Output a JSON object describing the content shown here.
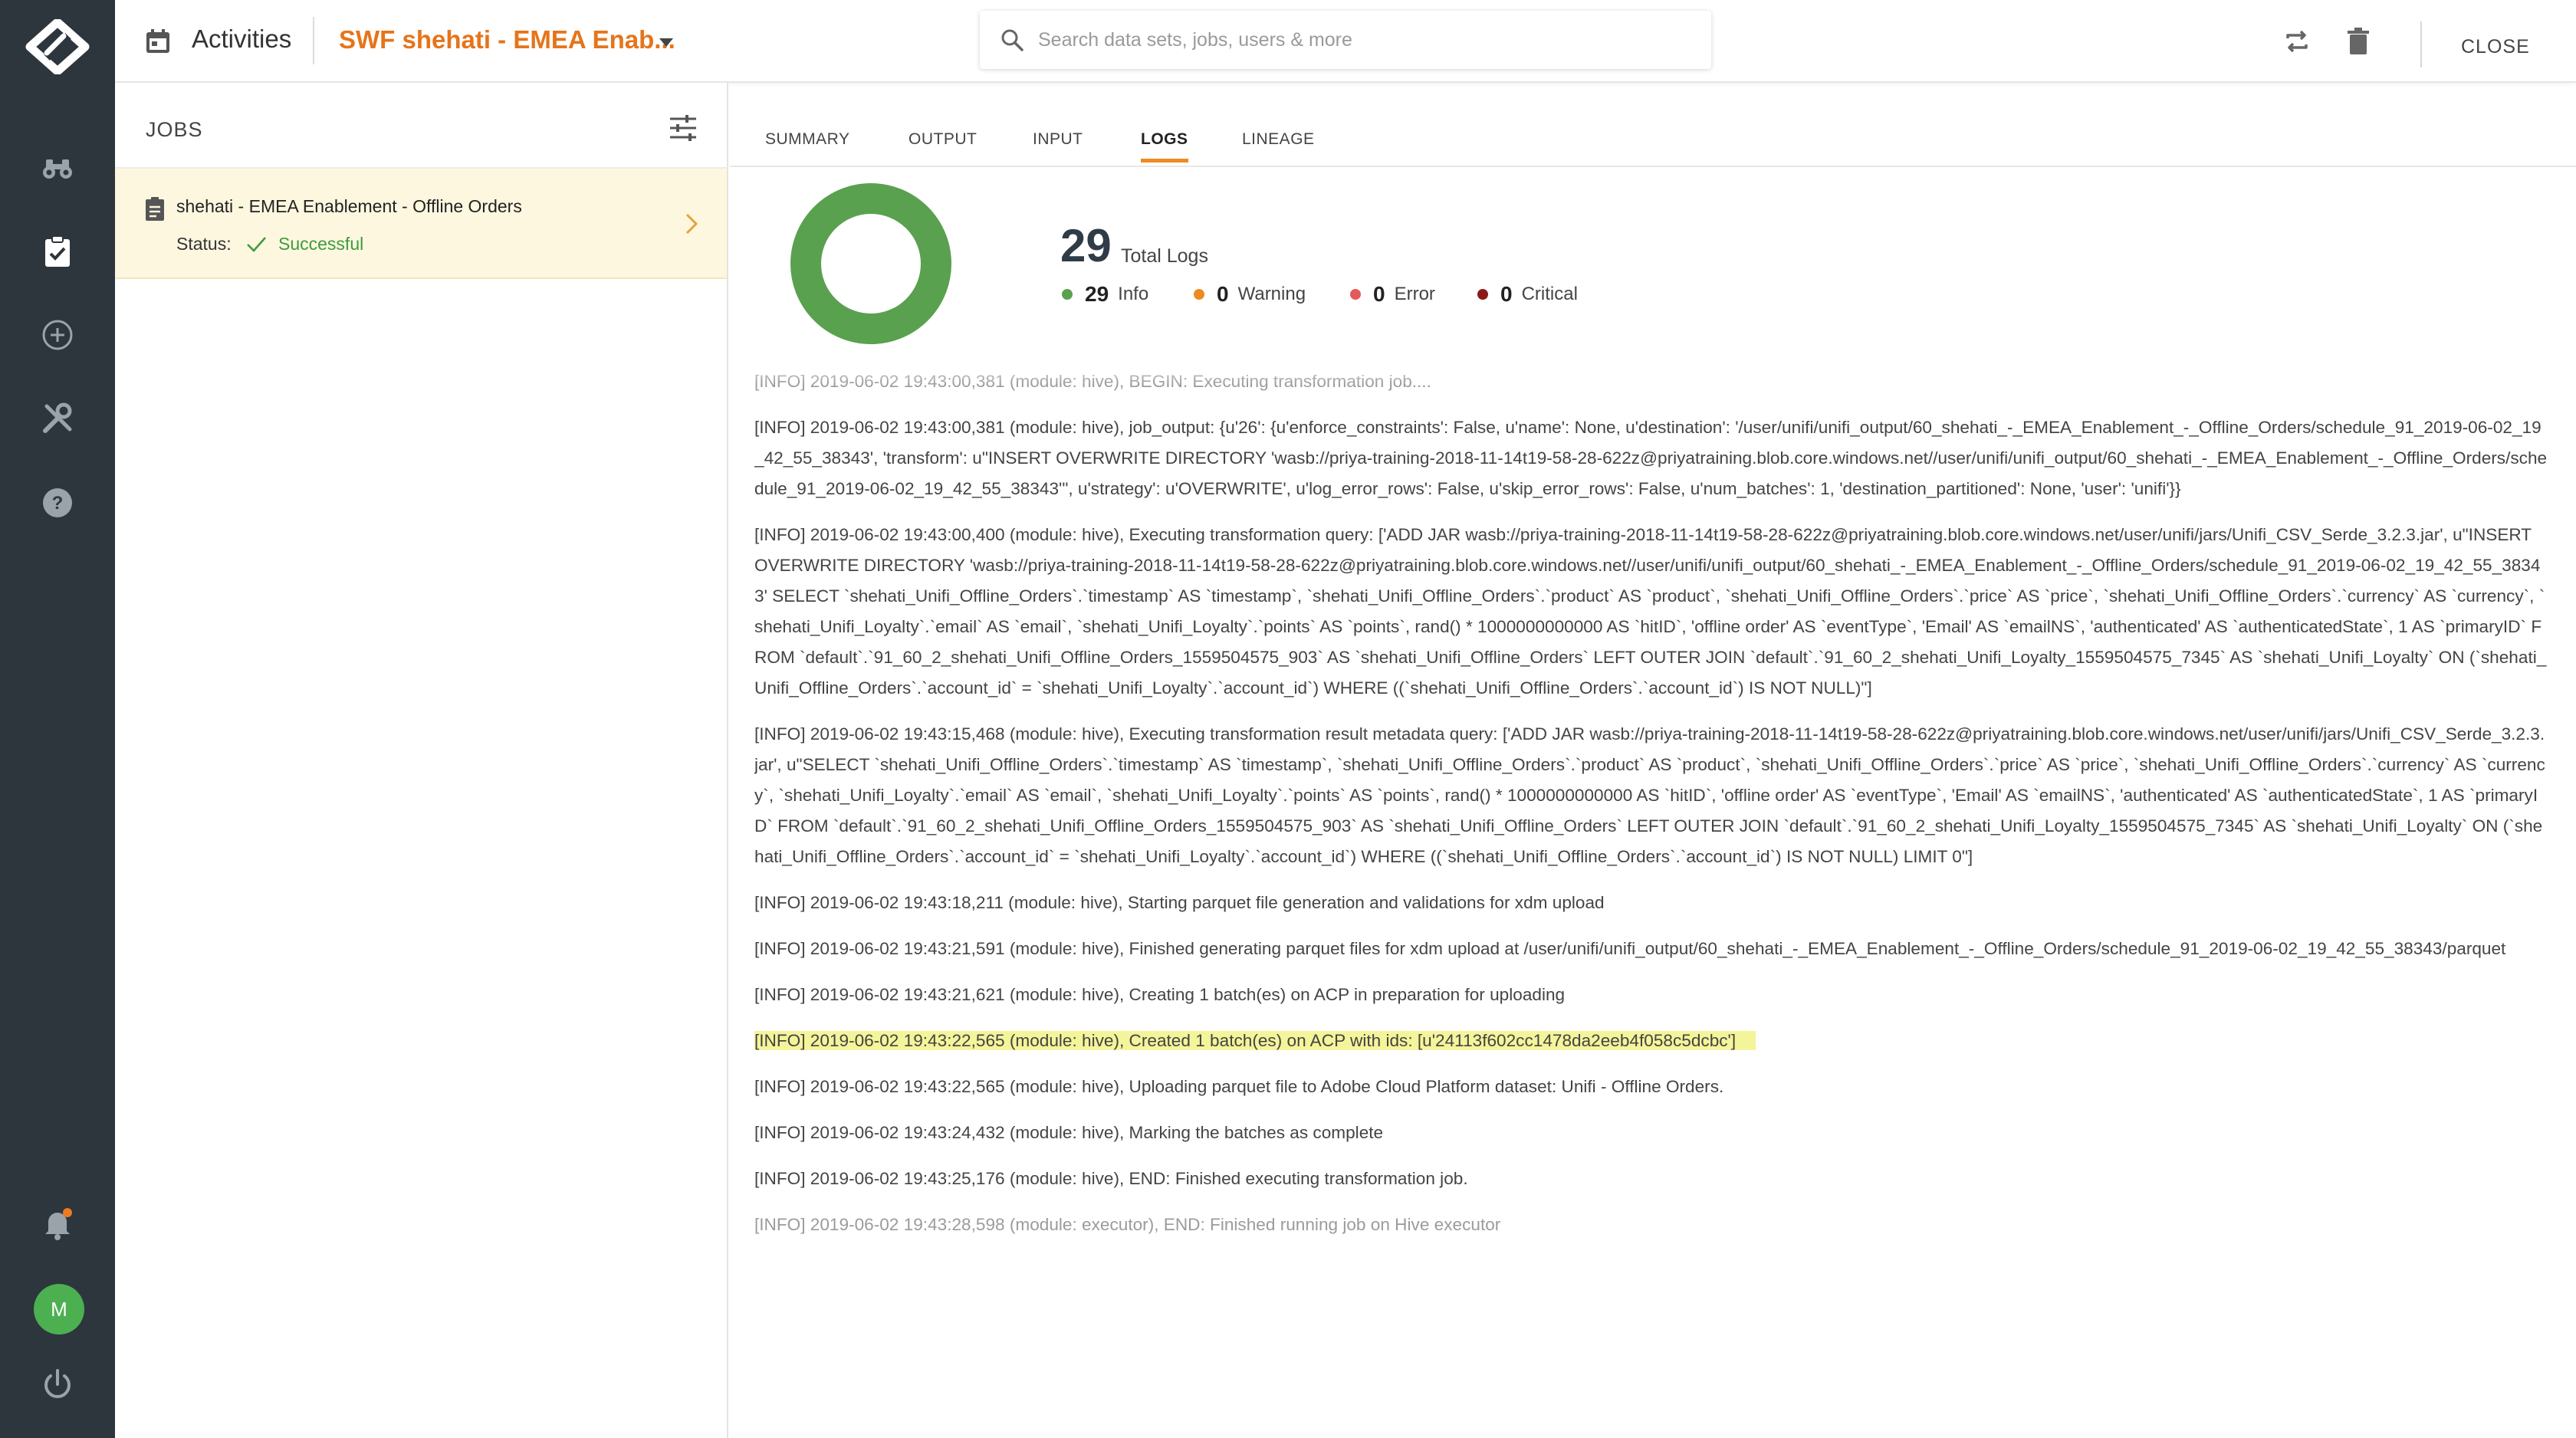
{
  "header": {
    "section": "Activities",
    "job_title": "SWF shehati - EMEA Enab...",
    "search_placeholder": "Search data sets, jobs, users & more",
    "close_label": "CLOSE"
  },
  "nav": {
    "items": [
      "binoculars-icon",
      "clipboard-check-icon",
      "plus-circle-icon",
      "tools-icon",
      "help-icon"
    ],
    "bottom": [
      "bell-icon",
      "avatar",
      "power-icon"
    ],
    "avatar_initial": "M",
    "notification_color": "#ee7a22"
  },
  "jobs_panel": {
    "heading": "JOBS",
    "items": [
      {
        "name": "shehati - EMEA Enablement - Offline Orders",
        "status_label": "Status:",
        "status": "Successful"
      }
    ]
  },
  "tabs": [
    {
      "label": "SUMMARY",
      "active": false
    },
    {
      "label": "OUTPUT",
      "active": false
    },
    {
      "label": "INPUT",
      "active": false
    },
    {
      "label": "LOGS",
      "active": true
    },
    {
      "label": "LINEAGE",
      "active": false
    }
  ],
  "summary": {
    "total": "29",
    "total_label": "Total Logs",
    "counts": [
      {
        "num": "29",
        "label": "Info",
        "color": "#5aa14f"
      },
      {
        "num": "0",
        "label": "Warning",
        "color": "#ee8a1f"
      },
      {
        "num": "0",
        "label": "Error",
        "color": "#e45a5a"
      },
      {
        "num": "0",
        "label": "Critical",
        "color": "#8b1a1a"
      }
    ],
    "donut_color": "#5aa14f"
  },
  "logs": [
    "[INFO] 2019-06-02 19:43:00,381 (module: hive), BEGIN: Executing transformation job....",
    "[INFO] 2019-06-02 19:43:00,381 (module: hive), job_output: {u'26': {u'enforce_constraints': False, u'name': None, u'destination': '/user/unifi/unifi_output/60_shehati_-_EMEA_Enablement_-_Offline_Orders/schedule_91_2019-06-02_19_42_55_38343', 'transform': u\"INSERT OVERWRITE DIRECTORY 'wasb://priya-training-2018-11-14t19-58-28-622z@priyatraining.blob.core.windows.net//user/unifi/unifi_output/60_shehati_-_EMEA_Enablement_-_Offline_Orders/schedule_91_2019-06-02_19_42_55_38343'\", u'strategy': u'OVERWRITE', u'log_error_rows': False, u'skip_error_rows': False, u'num_batches': 1, 'destination_partitioned': None, 'user': 'unifi'}}",
    "[INFO] 2019-06-02 19:43:00,400 (module: hive), Executing transformation query: ['ADD JAR wasb://priya-training-2018-11-14t19-58-28-622z@priyatraining.blob.core.windows.net/user/unifi/jars/Unifi_CSV_Serde_3.2.3.jar', u\"INSERT OVERWRITE DIRECTORY 'wasb://priya-training-2018-11-14t19-58-28-622z@priyatraining.blob.core.windows.net//user/unifi/unifi_output/60_shehati_-_EMEA_Enablement_-_Offline_Orders/schedule_91_2019-06-02_19_42_55_38343' SELECT `shehati_Unifi_Offline_Orders`.`timestamp` AS `timestamp`, `shehati_Unifi_Offline_Orders`.`product` AS `product`, `shehati_Unifi_Offline_Orders`.`price` AS `price`, `shehati_Unifi_Offline_Orders`.`currency` AS `currency`, `shehati_Unifi_Loyalty`.`email` AS `email`, `shehati_Unifi_Loyalty`.`points` AS `points`, rand() * 1000000000000 AS `hitID`, 'offline order' AS `eventType`, 'Email' AS `emailNS`, 'authenticated' AS `authenticatedState`, 1 AS `primaryID` FROM `default`.`91_60_2_shehati_Unifi_Offline_Orders_1559504575_903` AS `shehati_Unifi_Offline_Orders` LEFT OUTER JOIN `default`.`91_60_2_shehati_Unifi_Loyalty_1559504575_7345` AS `shehati_Unifi_Loyalty` ON (`shehati_Unifi_Offline_Orders`.`account_id` = `shehati_Unifi_Loyalty`.`account_id`) WHERE ((`shehati_Unifi_Offline_Orders`.`account_id`) IS NOT NULL)\"]",
    "[INFO] 2019-06-02 19:43:15,468 (module: hive), Executing transformation result metadata query: ['ADD JAR wasb://priya-training-2018-11-14t19-58-28-622z@priyatraining.blob.core.windows.net/user/unifi/jars/Unifi_CSV_Serde_3.2.3.jar', u\"SELECT `shehati_Unifi_Offline_Orders`.`timestamp` AS `timestamp`, `shehati_Unifi_Offline_Orders`.`product` AS `product`, `shehati_Unifi_Offline_Orders`.`price` AS `price`, `shehati_Unifi_Offline_Orders`.`currency` AS `currency`, `shehati_Unifi_Loyalty`.`email` AS `email`, `shehati_Unifi_Loyalty`.`points` AS `points`, rand() * 1000000000000 AS `hitID`, 'offline order' AS `eventType`, 'Email' AS `emailNS`, 'authenticated' AS `authenticatedState`, 1 AS `primaryID` FROM `default`.`91_60_2_shehati_Unifi_Offline_Orders_1559504575_903` AS `shehati_Unifi_Offline_Orders` LEFT OUTER JOIN `default`.`91_60_2_shehati_Unifi_Loyalty_1559504575_7345` AS `shehati_Unifi_Loyalty` ON (`shehati_Unifi_Offline_Orders`.`account_id` = `shehati_Unifi_Loyalty`.`account_id`) WHERE ((`shehati_Unifi_Offline_Orders`.`account_id`) IS NOT NULL) LIMIT 0\"]",
    "[INFO] 2019-06-02 19:43:18,211 (module: hive), Starting parquet file generation and validations for xdm upload",
    "[INFO] 2019-06-02 19:43:21,591 (module: hive), Finished generating parquet files for xdm upload at /user/unifi/unifi_output/60_shehati_-_EMEA_Enablement_-_Offline_Orders/schedule_91_2019-06-02_19_42_55_38343/parquet",
    "[INFO] 2019-06-02 19:43:21,621 (module: hive), Creating 1 batch(es) on ACP in preparation for uploading",
    "[INFO] 2019-06-02 19:43:22,565 (module: hive), Created 1 batch(es) on ACP with ids: [u'24113f602cc1478da2eeb4f058c5dcbc']",
    "[INFO] 2019-06-02 19:43:22,565 (module: hive), Uploading parquet file to Adobe Cloud Platform dataset: Unifi - Offline Orders.",
    "[INFO] 2019-06-02 19:43:24,432 (module: hive), Marking the batches as complete",
    "[INFO] 2019-06-02 19:43:25,176 (module: hive), END: Finished executing transformation job.",
    "[INFO] 2019-06-02 19:43:28,598 (module: executor), END: Finished running job on Hive executor"
  ],
  "highlight_color": "#f4f49a"
}
